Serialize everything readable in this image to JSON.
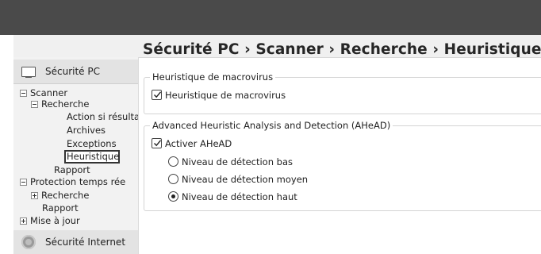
{
  "breadcrumb": {
    "title": "Sécurité PC › Scanner › Recherche › Heuristique"
  },
  "sidebar": {
    "section_pc": "Sécurité PC",
    "section_internet": "Sécurité Internet",
    "tree": {
      "scanner": "Scanner",
      "recherche": "Recherche",
      "action": "Action si résulta",
      "archives": "Archives",
      "exceptions": "Exceptions",
      "heuristique": "Heuristique",
      "rapport": "Rapport",
      "protection": "Protection temps rée",
      "recherche2": "Recherche",
      "rapport2": "Rapport",
      "mise_a_jour": "Mise à jour"
    },
    "selected": "Heuristique"
  },
  "macro_group": {
    "title": "Heuristique de macrovirus",
    "checkbox_label": "Heuristique de macrovirus",
    "checked": true
  },
  "ahead_group": {
    "title": "Advanced Heuristic Analysis and Detection (AHeAD)",
    "checkbox_label": "Activer AHeAD",
    "checked": true,
    "levels": [
      {
        "label": "Niveau de détection bas",
        "selected": false
      },
      {
        "label": "Niveau de détection moyen",
        "selected": false
      },
      {
        "label": "Niveau de détection haut",
        "selected": true
      }
    ]
  }
}
